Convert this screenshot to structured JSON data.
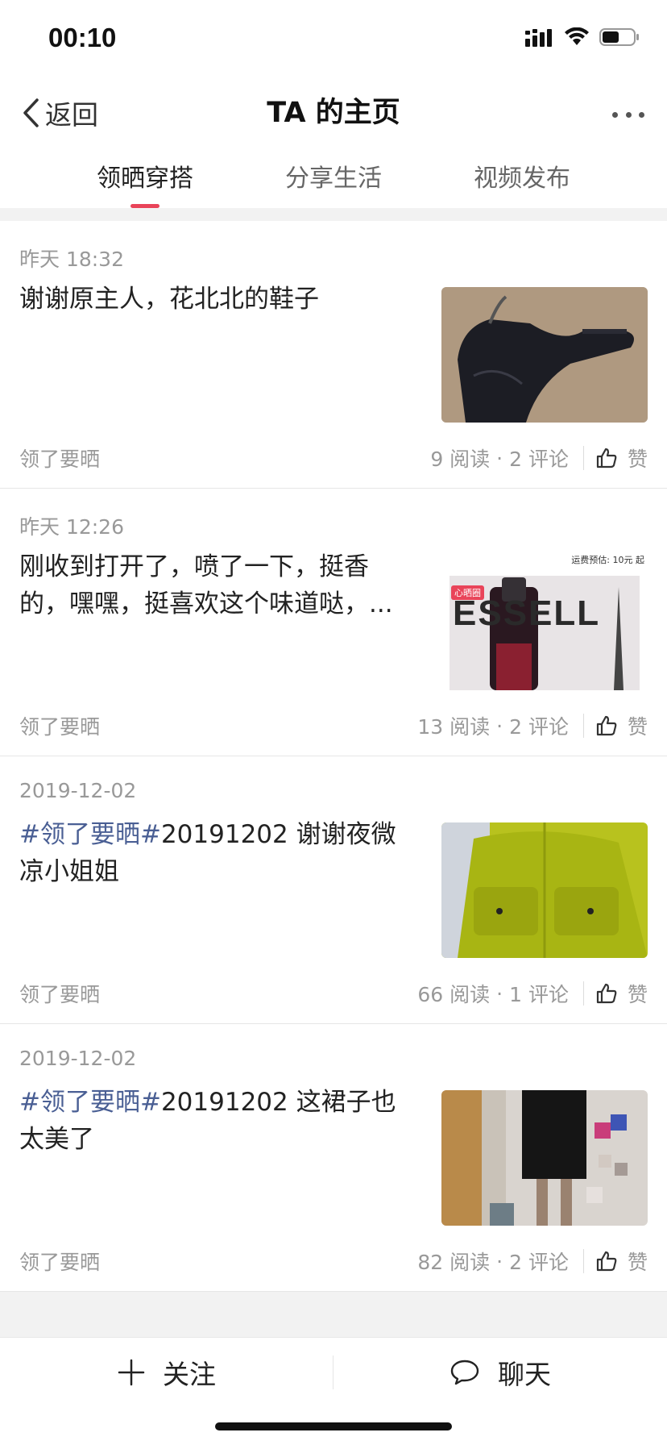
{
  "status_bar": {
    "time": "00:10"
  },
  "nav": {
    "back_label": "返回",
    "title": "TA 的主页"
  },
  "tabs": [
    {
      "label": "领晒穿搭",
      "active": true
    },
    {
      "label": "分享生活",
      "active": false
    },
    {
      "label": "视频发布",
      "active": false
    }
  ],
  "posts": [
    {
      "date": "昨天 18:32",
      "text": "谢谢原主人，花北北的鞋子",
      "source": "领了要晒",
      "reads": "9 阅读",
      "comments": "2 评论",
      "like_label": "赞"
    },
    {
      "date": "昨天 12:26",
      "text": "刚收到打开了，喷了一下，挺香的，嘿嘿，挺喜欢这个味道哒，...",
      "source": "领了要晒",
      "reads": "13 阅读",
      "comments": "2 评论",
      "like_label": "赞",
      "thumb_text": {
        "shipping": "运费预估: 10元 起",
        "banner": "ESSELL",
        "tag": "心晒圈"
      }
    },
    {
      "date": "2019-12-02",
      "hashtag": "#领了要晒#",
      "text": "20191202 谢谢夜微凉小姐姐",
      "source": "领了要晒",
      "reads": "66 阅读",
      "comments": "1 评论",
      "like_label": "赞"
    },
    {
      "date": "2019-12-02",
      "hashtag": "#领了要晒#",
      "text": "20191202 这裙子也太美了",
      "source": "领了要晒",
      "reads": "82 阅读",
      "comments": "2 评论",
      "like_label": "赞"
    }
  ],
  "actions": {
    "follow_label": "关注",
    "chat_label": "聊天"
  },
  "colors": {
    "accent": "#e94459",
    "hashtag": "#4a5f94"
  }
}
